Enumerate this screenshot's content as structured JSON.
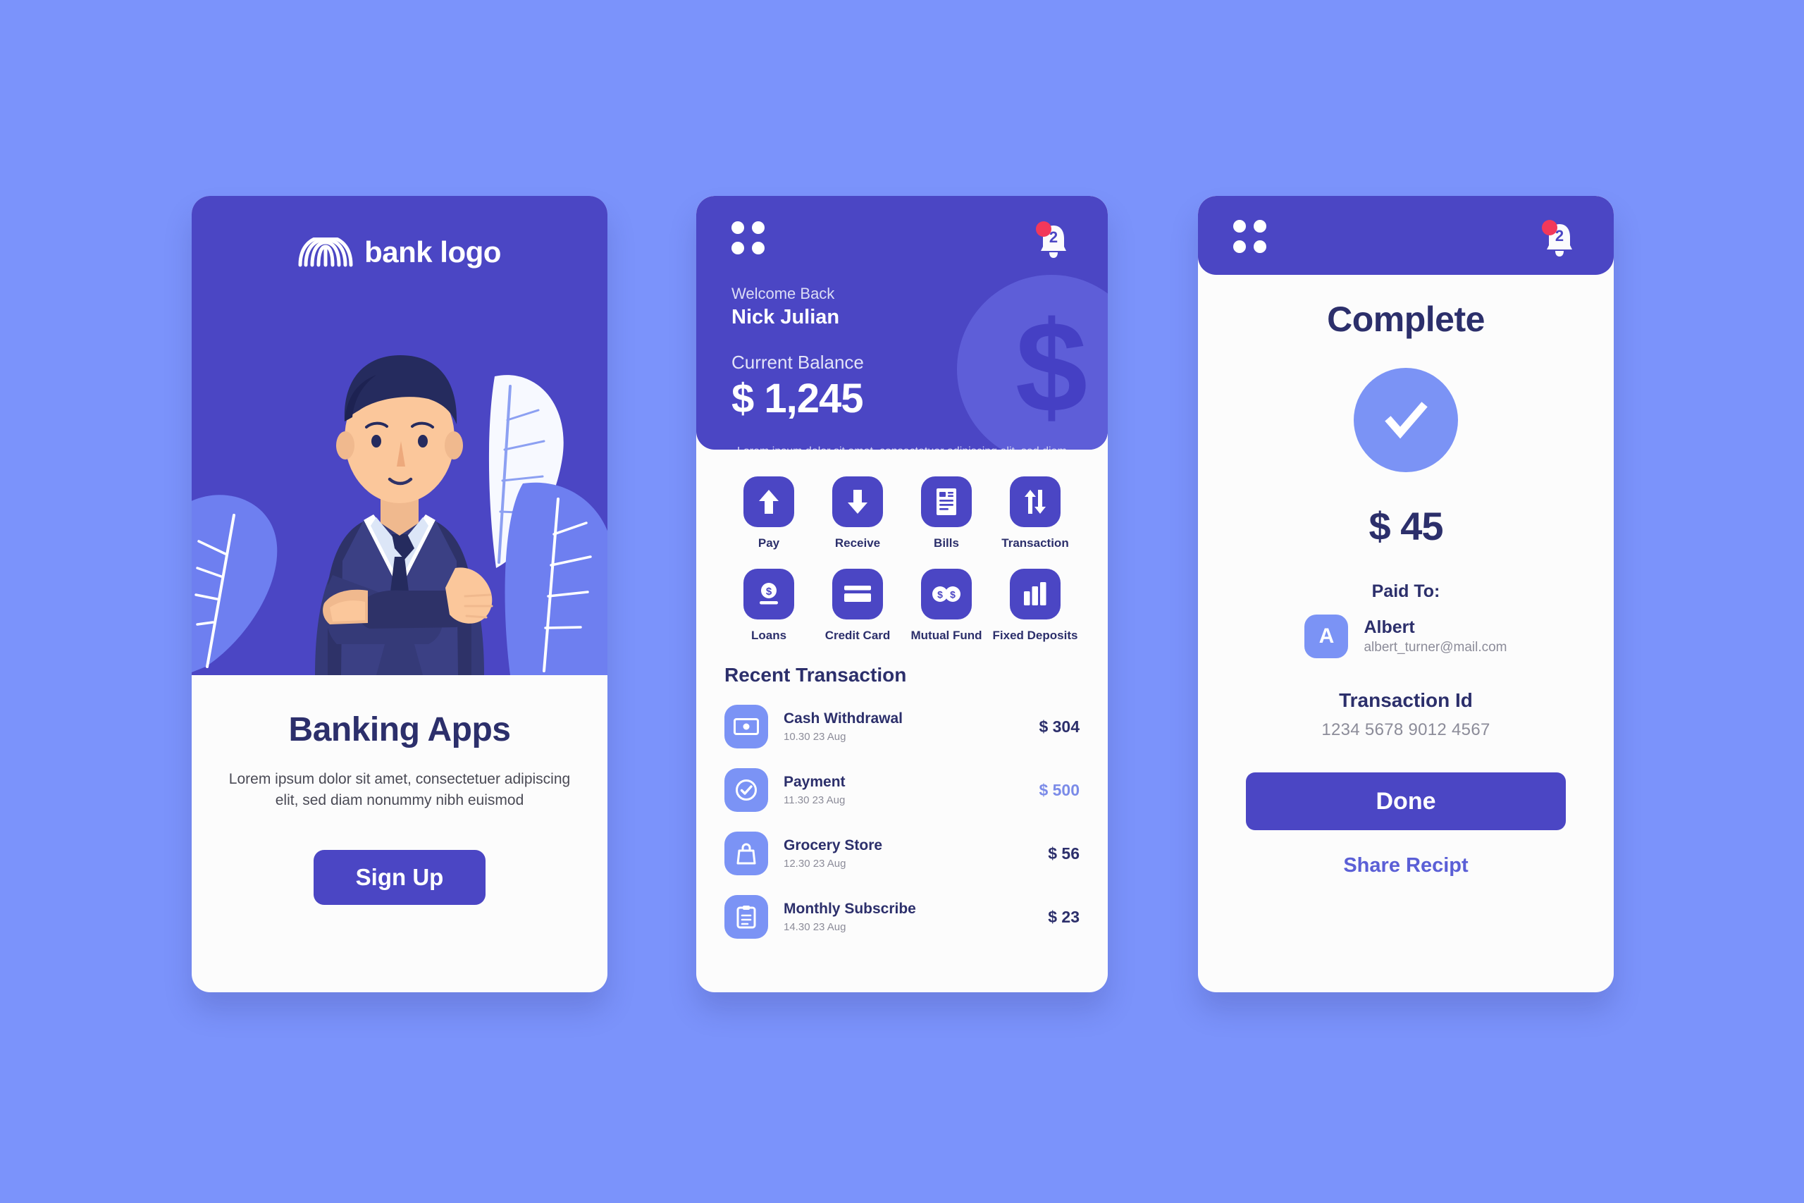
{
  "theme": {
    "page_background": "#7B93FB",
    "primary": "#4B46C4",
    "accent_light": "#7B93F5",
    "text_dark": "#2C2F6B",
    "text_muted": "#8C8C99",
    "badge_red": "#F2385A",
    "card_surface": "#FCFCFC"
  },
  "onboarding": {
    "logo_icon": "arch-rainbow-logo-icon",
    "logo_text": "bank logo",
    "illustration": "businessman-arms-crossed-illustration",
    "title": "Banking Apps",
    "description": "Lorem ipsum dolor sit amet, consectetuer adipiscing elit, sed diam nonummy nibh euismod",
    "signup_label": "Sign Up"
  },
  "dashboard": {
    "menu_icon": "grid-dots-icon",
    "bell_icon": "bell-icon",
    "notification_count": "2",
    "welcome_label": "Welcome Back",
    "user_name": "Nick Julian",
    "balance_label": "Current Balance",
    "balance_value": "$ 1,245",
    "watermark_symbol": "$",
    "note": "Lorem ipsum dolor sit amet, consectetuer adipiscing elit, sed diam nonummy nibh euismod",
    "actions": [
      {
        "label": "Pay",
        "icon": "arrow-up-icon"
      },
      {
        "label": "Receive",
        "icon": "arrow-down-icon"
      },
      {
        "label": "Bills",
        "icon": "document-bill-icon"
      },
      {
        "label": "Transaction",
        "icon": "transfer-arrows-icon"
      },
      {
        "label": "Loans",
        "icon": "coin-dollar-icon"
      },
      {
        "label": "Credit Card",
        "icon": "credit-card-icon"
      },
      {
        "label": "Mutual Fund",
        "icon": "two-coins-icon"
      },
      {
        "label": "Fixed Deposits",
        "icon": "bar-chart-icon"
      }
    ],
    "recent_title": "Recent Transaction",
    "transactions": [
      {
        "name": "Cash Withdrawal",
        "date": "10.30 23 Aug",
        "amount": "$ 304",
        "icon": "banknote-icon",
        "highlight": false
      },
      {
        "name": "Payment",
        "date": "11.30 23 Aug",
        "amount": "$ 500",
        "icon": "check-circle-icon",
        "highlight": true
      },
      {
        "name": "Grocery Store",
        "date": "12.30 23  Aug",
        "amount": "$ 56",
        "icon": "shopping-bag-icon",
        "highlight": false
      },
      {
        "name": "Monthly Subscribe",
        "date": "14.30 23  Aug",
        "amount": "$ 23",
        "icon": "clipboard-icon",
        "highlight": false
      }
    ]
  },
  "complete": {
    "menu_icon": "grid-dots-icon",
    "bell_icon": "bell-icon",
    "notification_count": "2",
    "title": "Complete",
    "status_icon": "check-circle-icon",
    "amount": "$ 45",
    "paid_to_label": "Paid To:",
    "payee_initial": "A",
    "payee_name": "Albert",
    "payee_email": "albert_turner@mail.com",
    "transaction_id_label": "Transaction Id",
    "transaction_id_value": "1234 5678 9012 4567",
    "done_label": "Done",
    "share_label": "Share Recipt"
  }
}
